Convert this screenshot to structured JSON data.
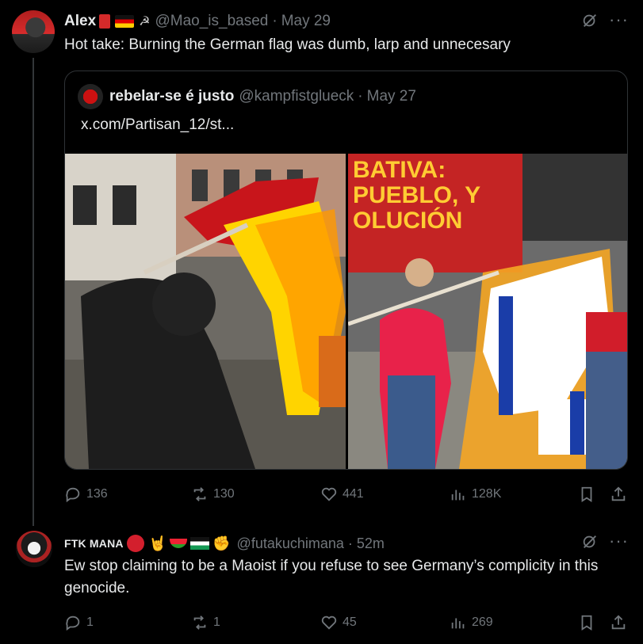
{
  "post1": {
    "name": "Alex",
    "emoji": "📕 🇩🇪 ☭",
    "handle": "@Mao_is_based",
    "sep": "·",
    "date": "May 29",
    "text": "Hot take: Burning the German flag was dumb, larp and unnecesary",
    "quote": {
      "name": "rebelar-se é justo",
      "handle": "@kampfistglueck",
      "sep": "·",
      "date": "May 27",
      "link": "x.com/Partisan_12/st..."
    },
    "stats": {
      "replies": "136",
      "reposts": "130",
      "likes": "441",
      "views": "128K"
    }
  },
  "post2": {
    "name": "FTK MANA",
    "emoji": "🔴 🤘 🍉 🇵🇸 ✊",
    "handle": "@futakuchimana",
    "sep": "·",
    "date": "52m",
    "text": "Ew stop claiming to be a Maoist if you refuse to see Germany’s complicity in this genocide.",
    "stats": {
      "replies": "1",
      "reposts": "1",
      "likes": "45",
      "views": "269"
    }
  },
  "more_label": "···",
  "colors": {
    "bg": "#000000",
    "text": "#e7e9ea",
    "muted": "#71767b",
    "border": "#2f3336"
  },
  "icons": [
    "grok-icon",
    "more-icon",
    "reply-icon",
    "repost-icon",
    "like-icon",
    "views-icon",
    "bookmark-icon",
    "share-icon"
  ]
}
